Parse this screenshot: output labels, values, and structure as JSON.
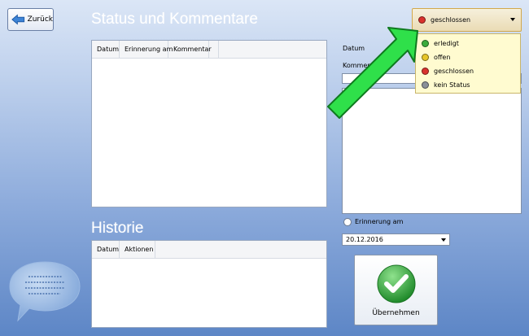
{
  "toolbar": {
    "back_label": "Zurück"
  },
  "comments_section": {
    "title": "Status und Kommentare",
    "columns": [
      "Datum",
      "Erinnerung am",
      "Kommentar",
      ""
    ]
  },
  "history_section": {
    "title": "Historie",
    "columns": [
      "Datum",
      "Aktionen"
    ]
  },
  "form": {
    "date_label": "Datum",
    "comment_label": "Kommentar",
    "reminder_label": "Erinnerung am",
    "reminder_date": "20.12.2016",
    "submit_label": "Übernehmen"
  },
  "status_dropdown": {
    "selected": "geschlossen",
    "selected_color": "#d9322d",
    "options": [
      {
        "label": "erledigt",
        "color": "#3aab3c"
      },
      {
        "label": "offen",
        "color": "#e6c528"
      },
      {
        "label": "geschlossen",
        "color": "#d9322d"
      },
      {
        "label": "kein Status",
        "color": "#8a9099"
      }
    ]
  },
  "colors": {
    "annotation_arrow": "#2fe04a",
    "checkmark": "#2ea83a"
  }
}
